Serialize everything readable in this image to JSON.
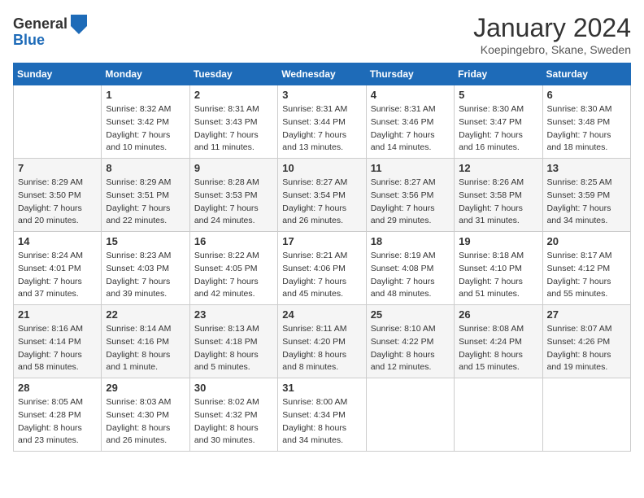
{
  "header": {
    "logo_line1": "General",
    "logo_line2": "Blue",
    "month_year": "January 2024",
    "location": "Koepingebro, Skane, Sweden"
  },
  "days_of_week": [
    "Sunday",
    "Monday",
    "Tuesday",
    "Wednesday",
    "Thursday",
    "Friday",
    "Saturday"
  ],
  "weeks": [
    [
      {
        "day": "",
        "sunrise": "",
        "sunset": "",
        "daylight": ""
      },
      {
        "day": "1",
        "sunrise": "Sunrise: 8:32 AM",
        "sunset": "Sunset: 3:42 PM",
        "daylight": "Daylight: 7 hours and 10 minutes."
      },
      {
        "day": "2",
        "sunrise": "Sunrise: 8:31 AM",
        "sunset": "Sunset: 3:43 PM",
        "daylight": "Daylight: 7 hours and 11 minutes."
      },
      {
        "day": "3",
        "sunrise": "Sunrise: 8:31 AM",
        "sunset": "Sunset: 3:44 PM",
        "daylight": "Daylight: 7 hours and 13 minutes."
      },
      {
        "day": "4",
        "sunrise": "Sunrise: 8:31 AM",
        "sunset": "Sunset: 3:46 PM",
        "daylight": "Daylight: 7 hours and 14 minutes."
      },
      {
        "day": "5",
        "sunrise": "Sunrise: 8:30 AM",
        "sunset": "Sunset: 3:47 PM",
        "daylight": "Daylight: 7 hours and 16 minutes."
      },
      {
        "day": "6",
        "sunrise": "Sunrise: 8:30 AM",
        "sunset": "Sunset: 3:48 PM",
        "daylight": "Daylight: 7 hours and 18 minutes."
      }
    ],
    [
      {
        "day": "7",
        "sunrise": "Sunrise: 8:29 AM",
        "sunset": "Sunset: 3:50 PM",
        "daylight": "Daylight: 7 hours and 20 minutes."
      },
      {
        "day": "8",
        "sunrise": "Sunrise: 8:29 AM",
        "sunset": "Sunset: 3:51 PM",
        "daylight": "Daylight: 7 hours and 22 minutes."
      },
      {
        "day": "9",
        "sunrise": "Sunrise: 8:28 AM",
        "sunset": "Sunset: 3:53 PM",
        "daylight": "Daylight: 7 hours and 24 minutes."
      },
      {
        "day": "10",
        "sunrise": "Sunrise: 8:27 AM",
        "sunset": "Sunset: 3:54 PM",
        "daylight": "Daylight: 7 hours and 26 minutes."
      },
      {
        "day": "11",
        "sunrise": "Sunrise: 8:27 AM",
        "sunset": "Sunset: 3:56 PM",
        "daylight": "Daylight: 7 hours and 29 minutes."
      },
      {
        "day": "12",
        "sunrise": "Sunrise: 8:26 AM",
        "sunset": "Sunset: 3:58 PM",
        "daylight": "Daylight: 7 hours and 31 minutes."
      },
      {
        "day": "13",
        "sunrise": "Sunrise: 8:25 AM",
        "sunset": "Sunset: 3:59 PM",
        "daylight": "Daylight: 7 hours and 34 minutes."
      }
    ],
    [
      {
        "day": "14",
        "sunrise": "Sunrise: 8:24 AM",
        "sunset": "Sunset: 4:01 PM",
        "daylight": "Daylight: 7 hours and 37 minutes."
      },
      {
        "day": "15",
        "sunrise": "Sunrise: 8:23 AM",
        "sunset": "Sunset: 4:03 PM",
        "daylight": "Daylight: 7 hours and 39 minutes."
      },
      {
        "day": "16",
        "sunrise": "Sunrise: 8:22 AM",
        "sunset": "Sunset: 4:05 PM",
        "daylight": "Daylight: 7 hours and 42 minutes."
      },
      {
        "day": "17",
        "sunrise": "Sunrise: 8:21 AM",
        "sunset": "Sunset: 4:06 PM",
        "daylight": "Daylight: 7 hours and 45 minutes."
      },
      {
        "day": "18",
        "sunrise": "Sunrise: 8:19 AM",
        "sunset": "Sunset: 4:08 PM",
        "daylight": "Daylight: 7 hours and 48 minutes."
      },
      {
        "day": "19",
        "sunrise": "Sunrise: 8:18 AM",
        "sunset": "Sunset: 4:10 PM",
        "daylight": "Daylight: 7 hours and 51 minutes."
      },
      {
        "day": "20",
        "sunrise": "Sunrise: 8:17 AM",
        "sunset": "Sunset: 4:12 PM",
        "daylight": "Daylight: 7 hours and 55 minutes."
      }
    ],
    [
      {
        "day": "21",
        "sunrise": "Sunrise: 8:16 AM",
        "sunset": "Sunset: 4:14 PM",
        "daylight": "Daylight: 7 hours and 58 minutes."
      },
      {
        "day": "22",
        "sunrise": "Sunrise: 8:14 AM",
        "sunset": "Sunset: 4:16 PM",
        "daylight": "Daylight: 8 hours and 1 minute."
      },
      {
        "day": "23",
        "sunrise": "Sunrise: 8:13 AM",
        "sunset": "Sunset: 4:18 PM",
        "daylight": "Daylight: 8 hours and 5 minutes."
      },
      {
        "day": "24",
        "sunrise": "Sunrise: 8:11 AM",
        "sunset": "Sunset: 4:20 PM",
        "daylight": "Daylight: 8 hours and 8 minutes."
      },
      {
        "day": "25",
        "sunrise": "Sunrise: 8:10 AM",
        "sunset": "Sunset: 4:22 PM",
        "daylight": "Daylight: 8 hours and 12 minutes."
      },
      {
        "day": "26",
        "sunrise": "Sunrise: 8:08 AM",
        "sunset": "Sunset: 4:24 PM",
        "daylight": "Daylight: 8 hours and 15 minutes."
      },
      {
        "day": "27",
        "sunrise": "Sunrise: 8:07 AM",
        "sunset": "Sunset: 4:26 PM",
        "daylight": "Daylight: 8 hours and 19 minutes."
      }
    ],
    [
      {
        "day": "28",
        "sunrise": "Sunrise: 8:05 AM",
        "sunset": "Sunset: 4:28 PM",
        "daylight": "Daylight: 8 hours and 23 minutes."
      },
      {
        "day": "29",
        "sunrise": "Sunrise: 8:03 AM",
        "sunset": "Sunset: 4:30 PM",
        "daylight": "Daylight: 8 hours and 26 minutes."
      },
      {
        "day": "30",
        "sunrise": "Sunrise: 8:02 AM",
        "sunset": "Sunset: 4:32 PM",
        "daylight": "Daylight: 8 hours and 30 minutes."
      },
      {
        "day": "31",
        "sunrise": "Sunrise: 8:00 AM",
        "sunset": "Sunset: 4:34 PM",
        "daylight": "Daylight: 8 hours and 34 minutes."
      },
      {
        "day": "",
        "sunrise": "",
        "sunset": "",
        "daylight": ""
      },
      {
        "day": "",
        "sunrise": "",
        "sunset": "",
        "daylight": ""
      },
      {
        "day": "",
        "sunrise": "",
        "sunset": "",
        "daylight": ""
      }
    ]
  ]
}
